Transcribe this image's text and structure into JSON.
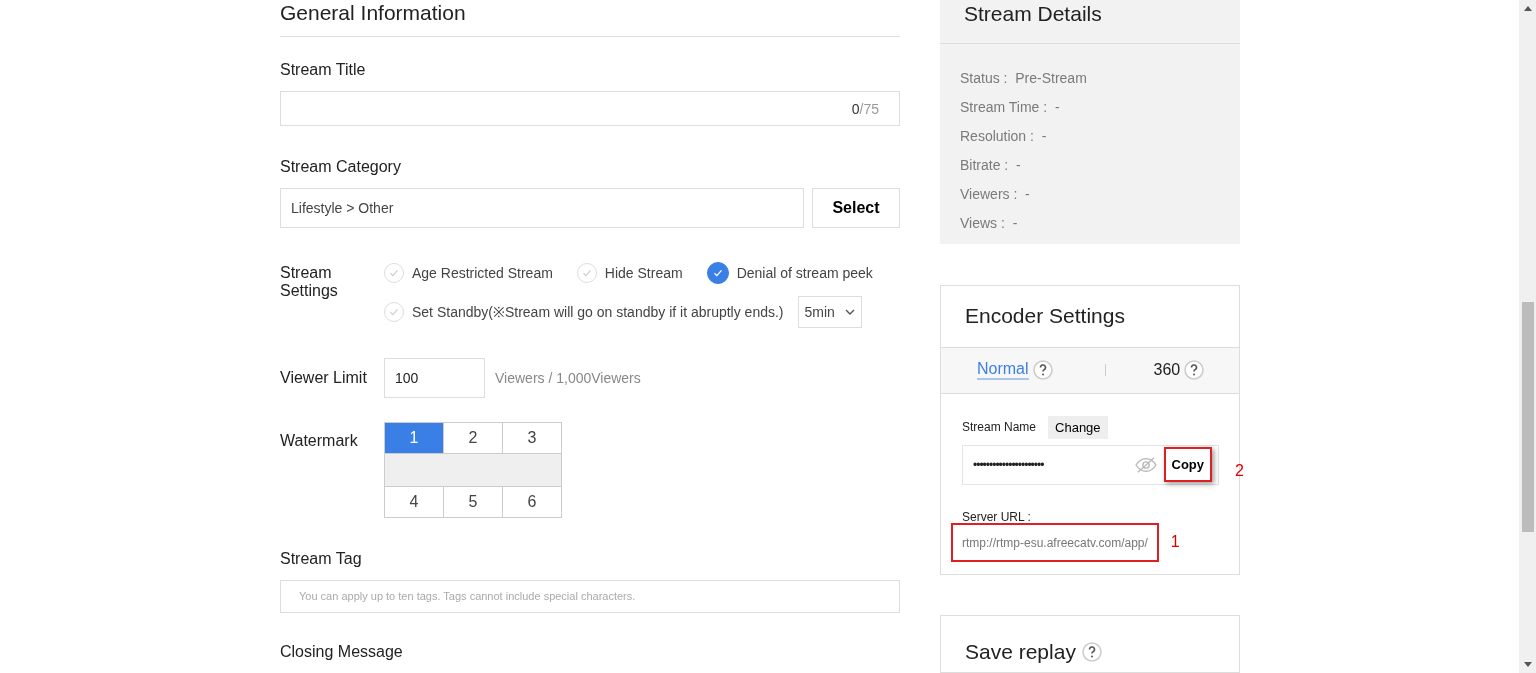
{
  "general": {
    "heading": "General Information",
    "title_label": "Stream Title",
    "title_count": "0",
    "title_max": "/75",
    "category_label": "Stream Category",
    "category_value": "Lifestyle > Other",
    "select_button": "Select",
    "settings_label": "Stream Settings",
    "settings": [
      {
        "label": "Age Restricted Stream",
        "checked": false
      },
      {
        "label": "Hide Stream",
        "checked": false
      },
      {
        "label": "Denial of stream peek",
        "checked": true
      },
      {
        "label": "Set Standby(※Stream will go on standby if it abruptly ends.)",
        "checked": false
      }
    ],
    "standby_value": "5min",
    "viewer_label": "Viewer Limit",
    "viewer_value": "100",
    "viewer_note": "Viewers / 1,000Viewers",
    "watermark_label": "Watermark",
    "watermark": [
      {
        "label": "1",
        "selected": true
      },
      {
        "label": "2",
        "selected": false
      },
      {
        "label": "3",
        "selected": false
      },
      {
        "label": "4",
        "selected": false
      },
      {
        "label": "5",
        "selected": false
      },
      {
        "label": "6",
        "selected": false
      }
    ],
    "tag_label": "Stream Tag",
    "tag_placeholder": "You can apply up to ten tags. Tags cannot include special characters.",
    "closing_label": "Closing Message"
  },
  "details": {
    "title": "Stream Details",
    "rows": [
      "Status :  Pre-Stream",
      "Stream Time :  -",
      "Resolution :  -",
      "Bitrate :  -",
      "Viewers :  -",
      "Views :  -"
    ]
  },
  "encoder": {
    "title": "Encoder Settings",
    "tabs": [
      {
        "label": "Normal",
        "selected": true
      },
      {
        "label": "360",
        "selected": false
      }
    ],
    "stream_name_label": "Stream Name",
    "change_button": "Change",
    "stream_key": "••••••••••••••••••••••",
    "copy_button": "Copy",
    "server_label": "Server URL :",
    "server_url": "rtmp://rtmp-esu.afreecatv.com/app/"
  },
  "annotations": [
    "1",
    "2"
  ],
  "replay": {
    "title": "Save replay"
  }
}
